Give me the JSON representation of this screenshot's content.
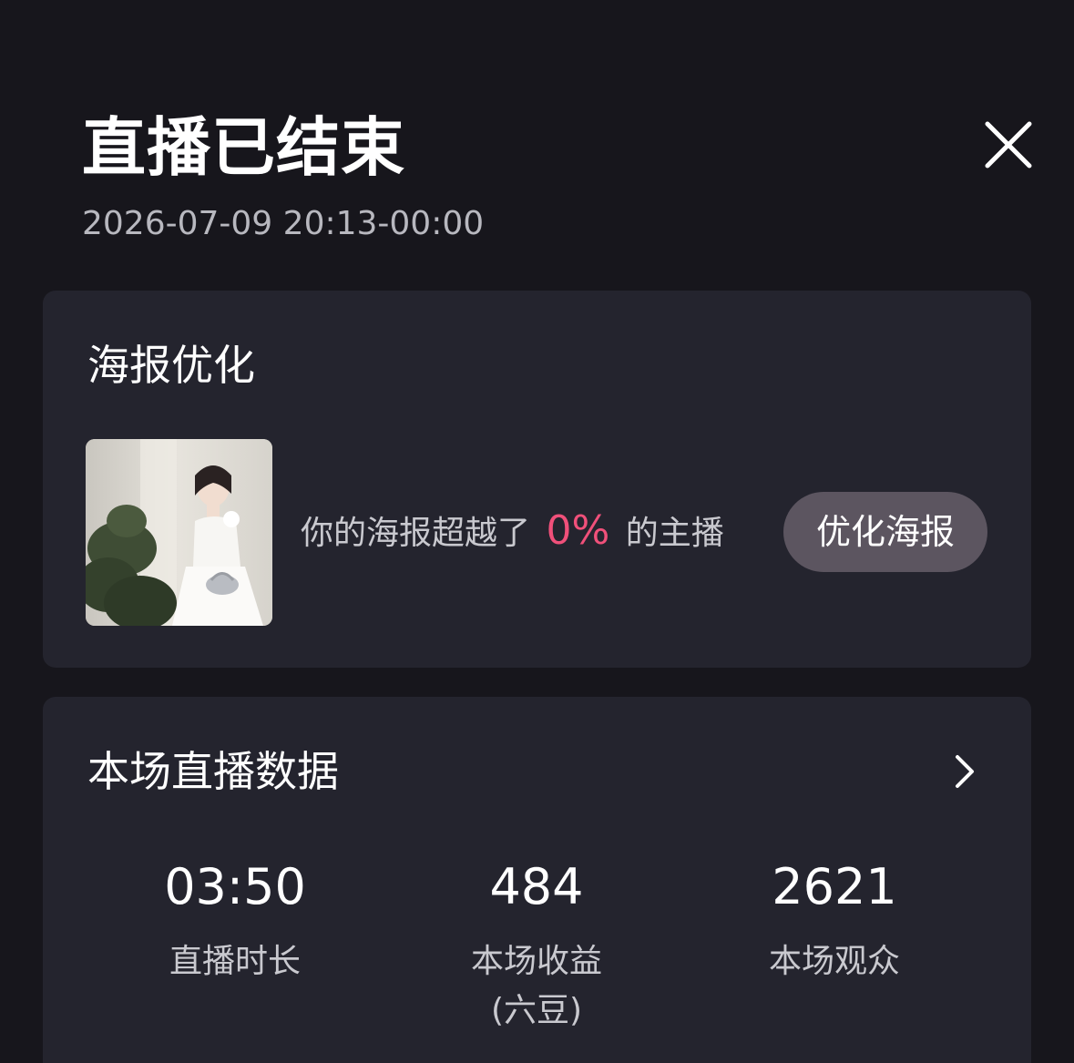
{
  "header": {
    "title": "直播已结束",
    "time_range": "2026-07-09 20:13-00:00"
  },
  "close_icon": "close-icon",
  "poster_card": {
    "title": "海报优化",
    "thumbnail": "poster-thumbnail",
    "rank_prefix": "你的海报超越了",
    "rank_percent": "0%",
    "rank_suffix": "的主播",
    "optimize_button": "优化海报"
  },
  "data_card": {
    "title": "本场直播数据",
    "chevron_icon": "chevron-right-icon",
    "stats": [
      {
        "value": "03:50",
        "label": "直播时长"
      },
      {
        "value": "484",
        "label": "本场收益",
        "sublabel": "(六豆)"
      },
      {
        "value": "2621",
        "label": "本场观众"
      }
    ]
  },
  "colors": {
    "background": "#17161c",
    "card": "#24242e",
    "accent": "#f0507a",
    "button": "#5c5560"
  }
}
